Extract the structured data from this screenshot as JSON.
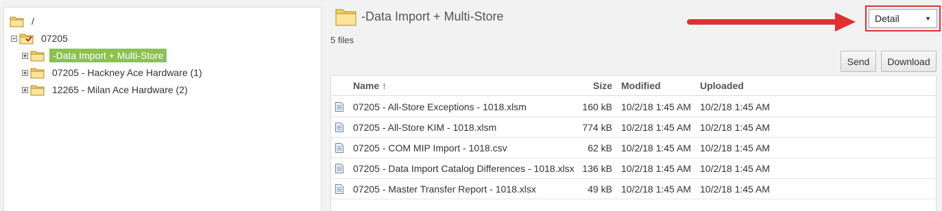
{
  "tree": {
    "root_label": "/",
    "node_07205": "07205",
    "children": [
      {
        "label": "-Data Import + Multi-Store",
        "selected": true
      },
      {
        "label": "07205 - Hackney Ace Hardware (1)",
        "selected": false
      },
      {
        "label": "12265 - Milan Ace Hardware (2)",
        "selected": false
      }
    ]
  },
  "header": {
    "title": "-Data Import + Multi-Store",
    "file_count": "5 files",
    "view_mode": "Detail"
  },
  "toolbar": {
    "send_label": "Send",
    "download_label": "Download"
  },
  "table": {
    "columns": {
      "name": "Name ↑",
      "size": "Size",
      "modified": "Modified",
      "uploaded": "Uploaded"
    },
    "rows": [
      {
        "name": "07205 - All-Store Exceptions - 1018.xlsm",
        "size": "160 kB",
        "modified": "10/2/18 1:45 AM",
        "uploaded": "10/2/18 1:45 AM"
      },
      {
        "name": "07205 - All-Store KIM - 1018.xlsm",
        "size": "774 kB",
        "modified": "10/2/18 1:45 AM",
        "uploaded": "10/2/18 1:45 AM"
      },
      {
        "name": "07205 - COM MIP Import - 1018.csv",
        "size": "62 kB",
        "modified": "10/2/18 1:45 AM",
        "uploaded": "10/2/18 1:45 AM"
      },
      {
        "name": "07205 - Data Import Catalog Differences - 1018.xlsx",
        "size": "136 kB",
        "modified": "10/2/18 1:45 AM",
        "uploaded": "10/2/18 1:45 AM"
      },
      {
        "name": "07205 - Master Transfer Report - 1018.xlsx",
        "size": "49 kB",
        "modified": "10/2/18 1:45 AM",
        "uploaded": "10/2/18 1:45 AM"
      }
    ]
  },
  "colors": {
    "selected_bg": "#8cc152",
    "annotation_red": "#e03131",
    "folder_yellow": "#f5d76e"
  },
  "icons": {
    "folder": "folder-icon",
    "document": "document-icon",
    "arrow": "red-arrow-annotation"
  }
}
